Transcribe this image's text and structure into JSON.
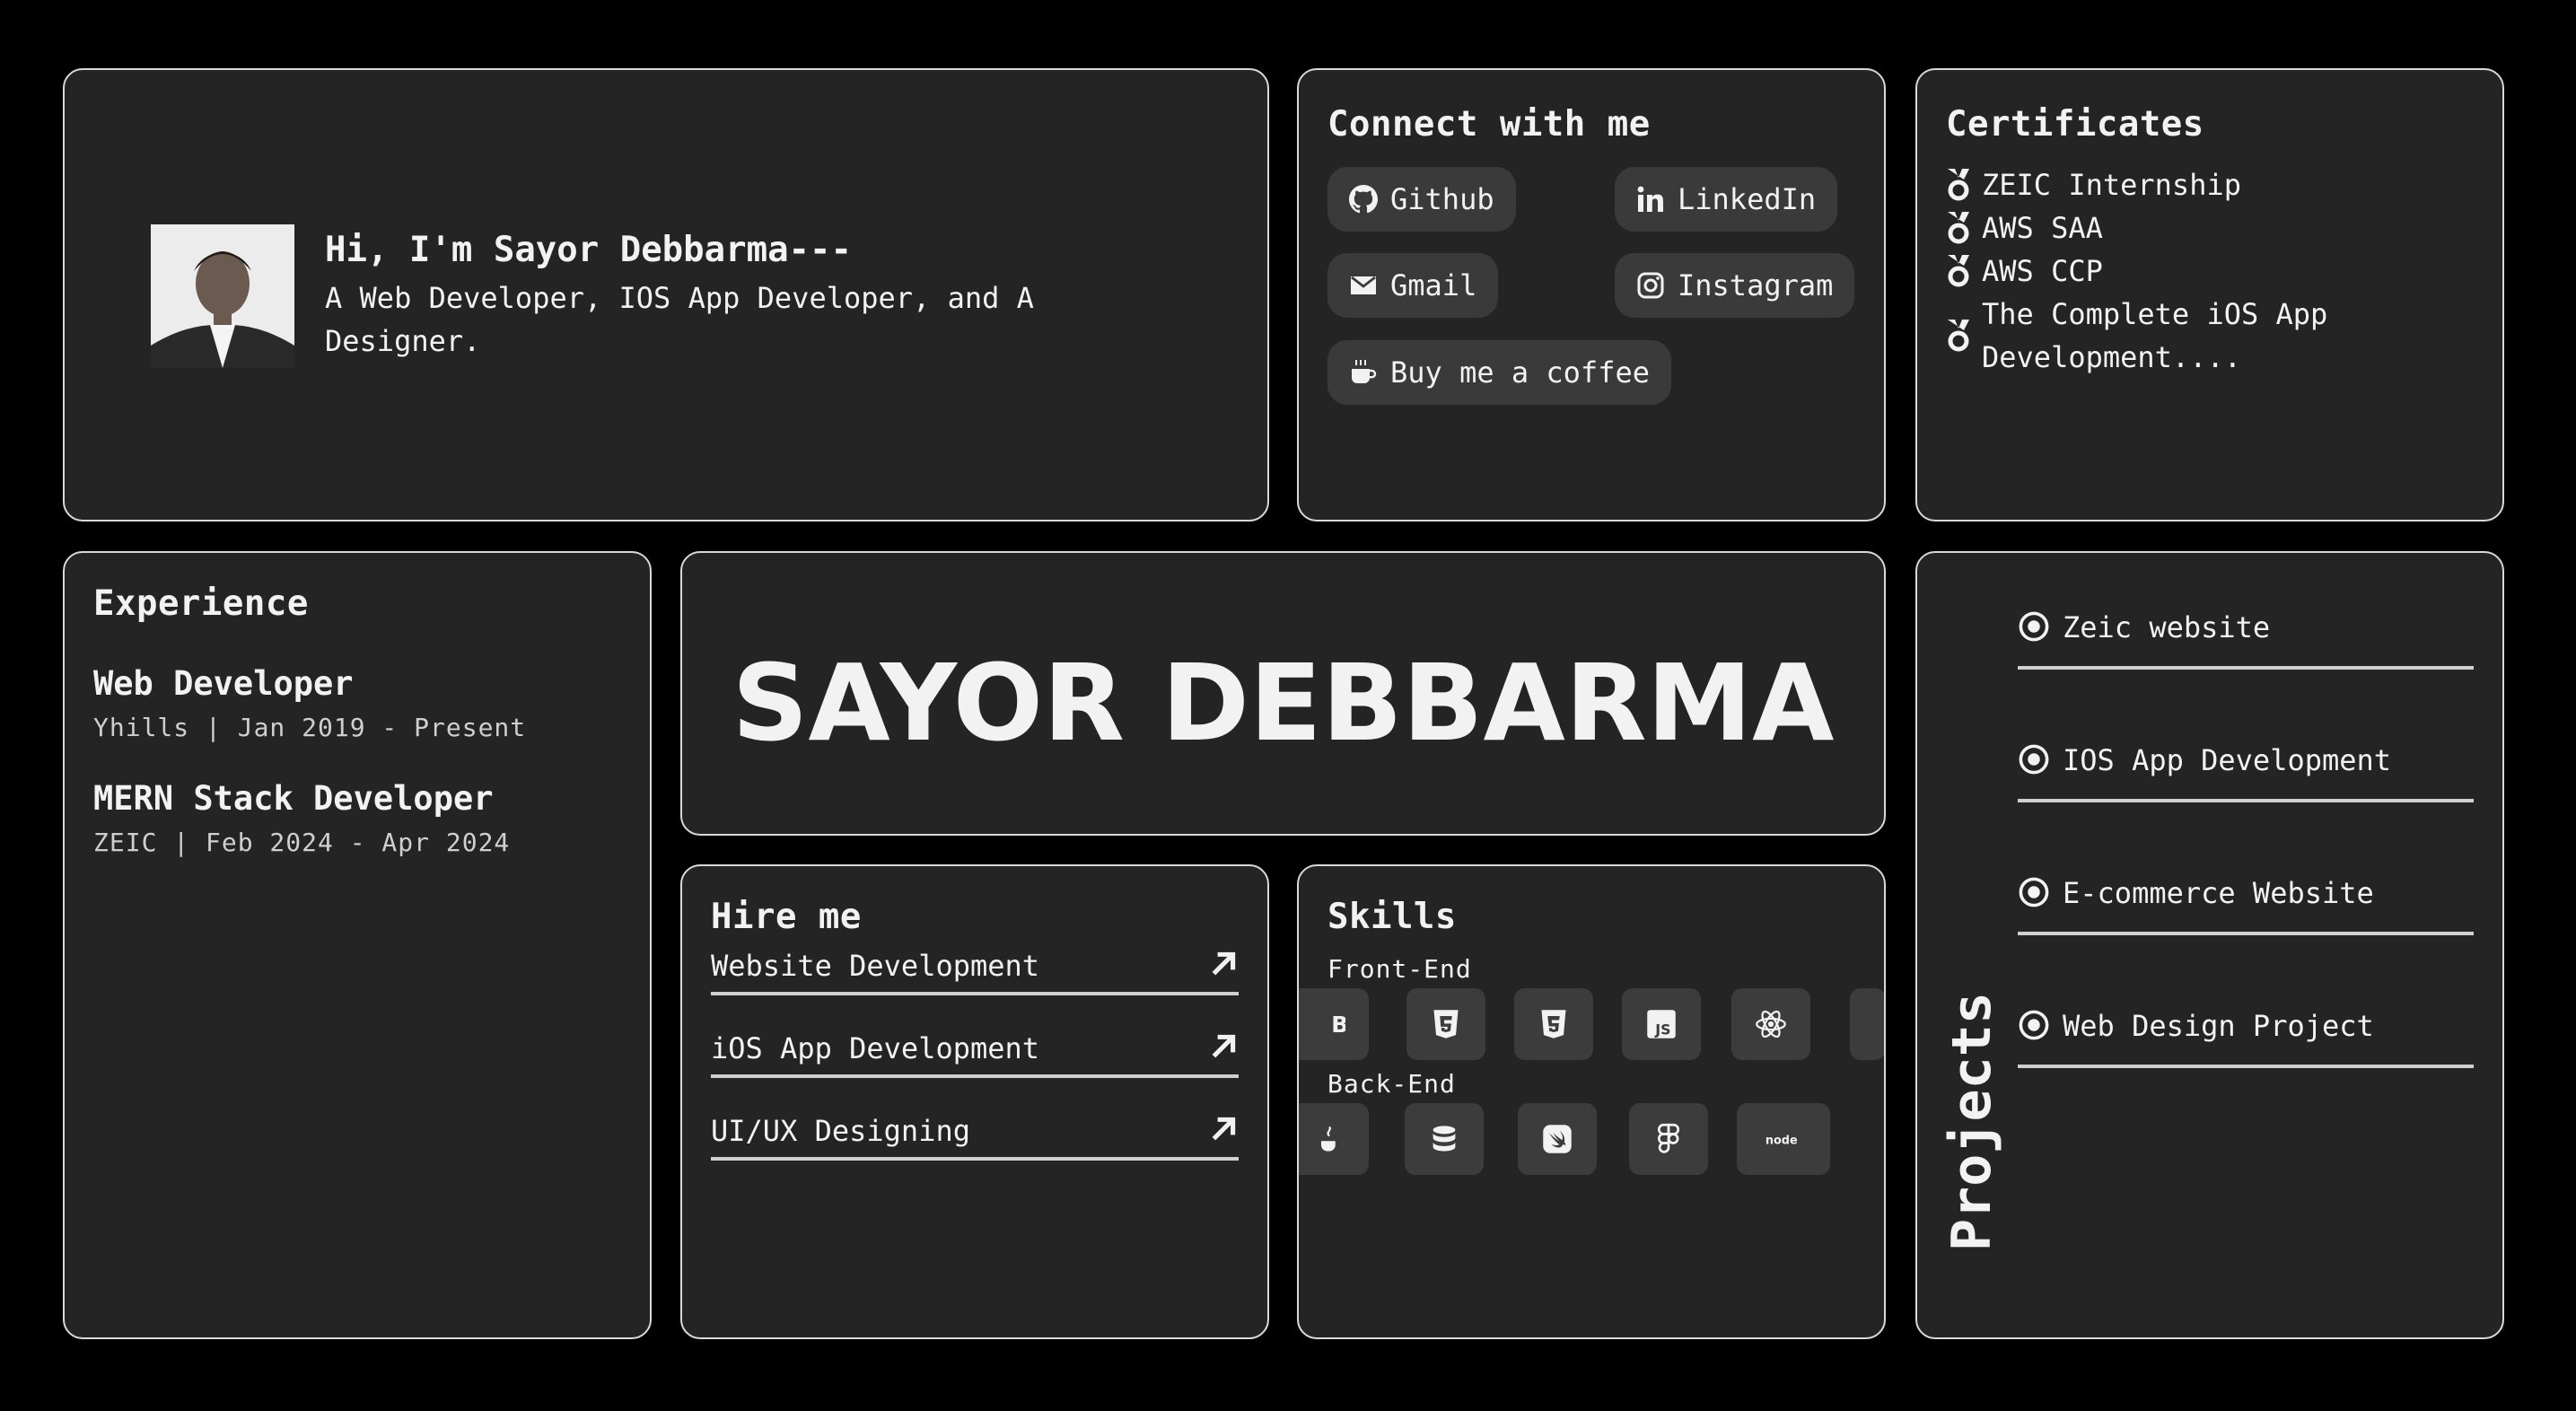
{
  "intro": {
    "greeting": "Hi, I'm Sayor Debbarma---",
    "tagline": "A Web Developer, IOS App Developer, and A Designer."
  },
  "connect": {
    "title": "Connect with me",
    "links": [
      {
        "label": "Github",
        "icon": "github-icon"
      },
      {
        "label": "LinkedIn",
        "icon": "linkedin-icon"
      },
      {
        "label": "Gmail",
        "icon": "mail-icon"
      },
      {
        "label": "Instagram",
        "icon": "instagram-icon"
      },
      {
        "label": "Buy me a coffee",
        "icon": "coffee-icon"
      }
    ]
  },
  "certificates": {
    "title": "Certificates",
    "items": [
      "ZEIC Internship",
      "AWS SAA",
      "AWS CCP",
      "The Complete iOS App",
      "Development...."
    ]
  },
  "experience": {
    "title": "Experience",
    "jobs": [
      {
        "role": "Web Developer",
        "meta": "Yhills | Jan 2019 - Present"
      },
      {
        "role": "MERN Stack Developer",
        "meta": "ZEIC | Feb 2024 - Apr 2024"
      }
    ]
  },
  "hero": {
    "name": "SAYOR DEBBARMA"
  },
  "hire": {
    "title": "Hire me",
    "items": [
      "Website Development",
      "iOS App Development",
      "UI/UX Designing"
    ]
  },
  "skills": {
    "title": "Skills",
    "frontend_label": "Front-End",
    "backend_label": "Back-End",
    "frontend_icons": [
      "bootstrap-icon",
      "html5-icon",
      "css3-icon",
      "javascript-icon",
      "react-icon"
    ],
    "backend_icons": [
      "java-icon",
      "database-icon",
      "swift-icon",
      "figma-icon",
      "nodejs-icon"
    ]
  },
  "projects": {
    "title": "Projects",
    "items": [
      "Zeic website",
      "IOS App Development",
      "E-commerce Website",
      "Web Design Project"
    ]
  },
  "colors": {
    "background": "#000000",
    "card": "#242424",
    "border": "#d9d9d9",
    "pill": "#3a3a3a",
    "text": "#f2f2f2"
  }
}
